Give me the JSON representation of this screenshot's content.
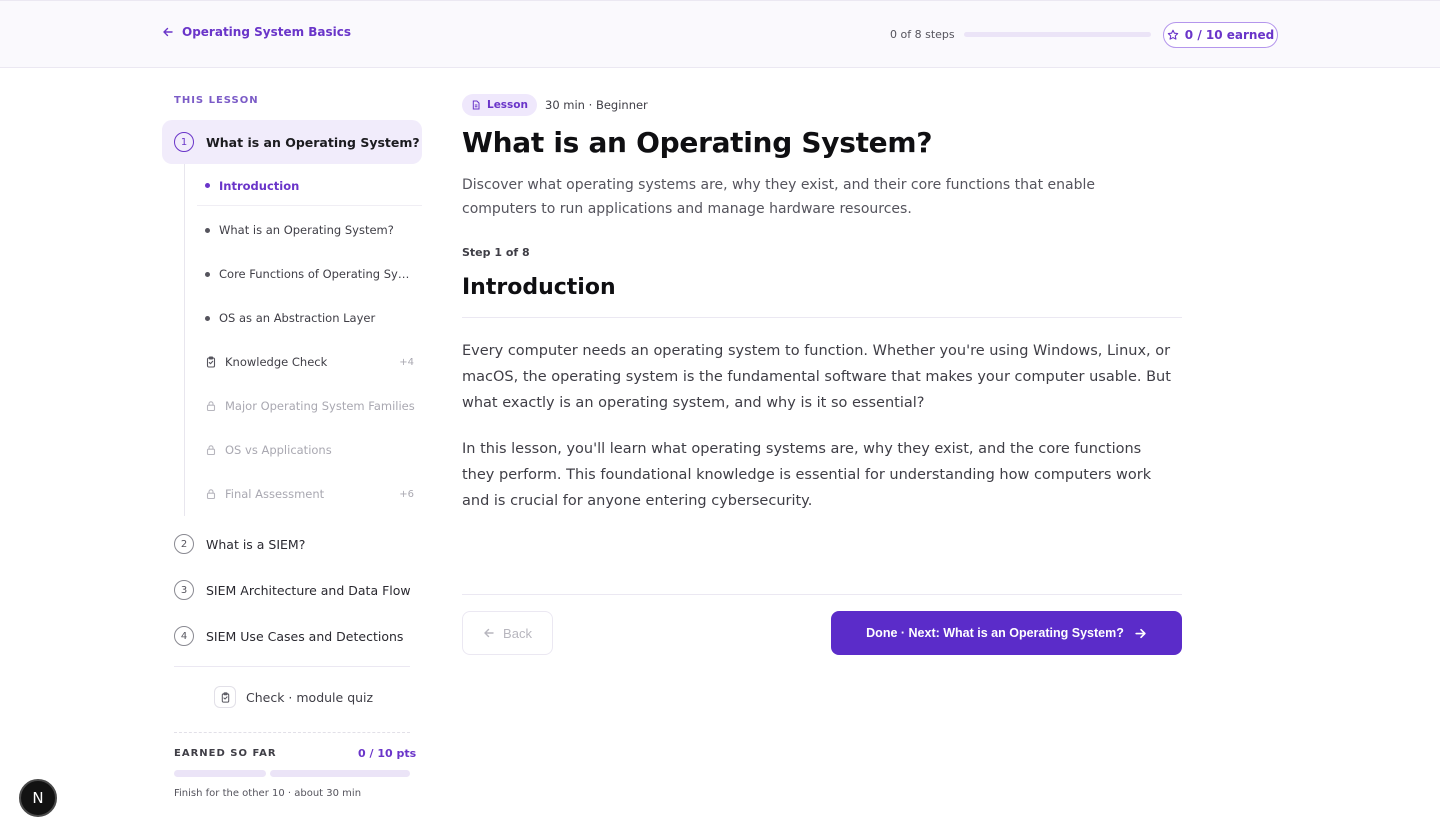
{
  "header": {
    "back_label": "Operating System Basics",
    "steps_text": "0 of 8 steps",
    "progress": 0,
    "earned_label": "0 / 10 earned"
  },
  "sidebar": {
    "heading": "THIS LESSON",
    "active_lesson": {
      "number": "1",
      "title": "What is an Operating System?"
    },
    "steps": [
      {
        "label": "Introduction",
        "kind": "dot",
        "state": "active",
        "points": ""
      },
      {
        "label": "What is an Operating System?",
        "kind": "dot",
        "state": "normal",
        "points": ""
      },
      {
        "label": "Core Functions of Operating Sy…",
        "kind": "dot",
        "state": "normal",
        "points": ""
      },
      {
        "label": "OS as an Abstraction Layer",
        "kind": "dot",
        "state": "normal",
        "points": ""
      },
      {
        "label": "Knowledge Check",
        "kind": "quiz",
        "state": "normal",
        "points": "+4"
      },
      {
        "label": "Major Operating System Families",
        "kind": "lock",
        "state": "locked",
        "points": ""
      },
      {
        "label": "OS vs Applications",
        "kind": "lock",
        "state": "locked",
        "points": ""
      },
      {
        "label": "Final Assessment",
        "kind": "lock",
        "state": "locked",
        "points": "+6"
      }
    ],
    "other_lessons": [
      {
        "number": "2",
        "title": "What is a SIEM?"
      },
      {
        "number": "3",
        "title": "SIEM Architecture and Data Flow"
      },
      {
        "number": "4",
        "title": "SIEM Use Cases and Detections"
      }
    ],
    "quiz_label": "Check · module quiz",
    "earned_heading": "EARNED SO FAR",
    "earned_points": "0 / 10 pts",
    "earned_note": "Finish for the other 10 · about 30 min"
  },
  "main": {
    "chip_label": "Lesson",
    "meta": "30 min · Beginner",
    "title": "What is an Operating System?",
    "description": "Discover what operating systems are, why they exist, and their core functions that enable computers to run applications and manage hardware resources.",
    "step_label": "Step 1 of 8",
    "section_title": "Introduction",
    "paragraphs": [
      "Every computer needs an operating system to function. Whether you're using Windows, Linux, or macOS, the operating system is the fundamental software that makes your computer usable. But what exactly is an operating system, and why is it so essential?",
      "In this lesson, you'll learn what operating systems are, why they exist, and the core functions they perform. This foundational knowledge is essential for understanding how computers work and is crucial for anyone entering cybersecurity."
    ],
    "back_label": "Back",
    "next_label": "Done · Next: What is an Operating System?"
  },
  "fab_label": "N",
  "colors": {
    "accent": "#6a35c9",
    "primary_button": "#5b2cc9"
  }
}
